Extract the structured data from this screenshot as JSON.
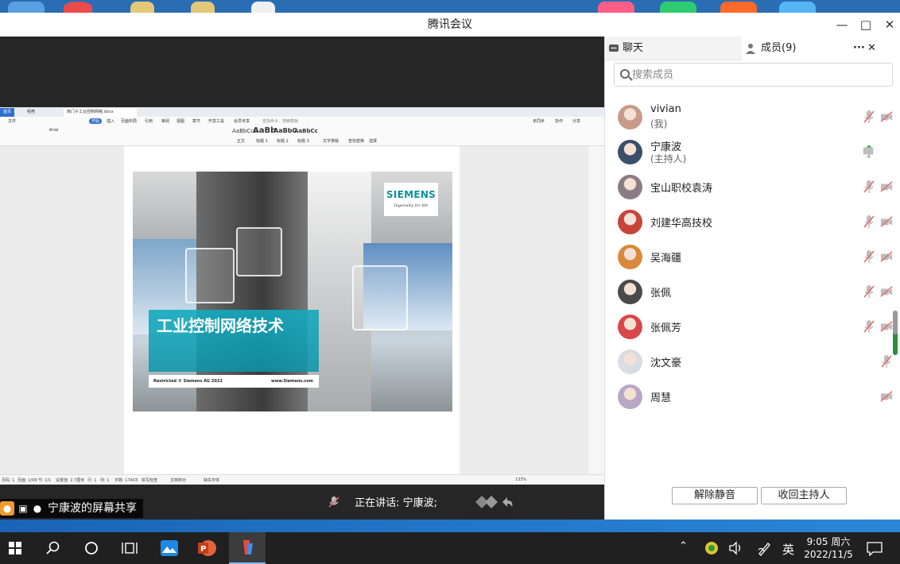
{
  "window": {
    "title": "腾讯会议"
  },
  "shared_screen": {
    "owner_label": "宁康波的屏幕共享",
    "speaking_prefix": "正在讲话:",
    "speaking_name": "宁康波;",
    "document": {
      "tabs": [
        "首页",
        "稻壳",
        "西门子工业控制网络.docx"
      ],
      "menu": [
        "文件",
        "开始",
        "插入",
        "页面布局",
        "引用",
        "审阅",
        "视图",
        "章节",
        "开发工具",
        "会员专享"
      ],
      "search_placeholder": "查找命令、搜索模板",
      "ribbon_styles": [
        "正文",
        "标题 1",
        "标题 2",
        "标题 3"
      ],
      "ribbon_tools": [
        "文字排版",
        "查找替换",
        "选择"
      ],
      "right_actions": [
        "未同步",
        "协作",
        "分享"
      ],
      "status": {
        "page": "页码: 1",
        "pages": "页面: 1/99",
        "section": "节: 1/1",
        "setting": "设置值: 2.7厘米",
        "row": "行: 1",
        "col": "列: 1",
        "words": "字数: 17403",
        "spell": "拼写检查",
        "proof": "文档校对",
        "font": "缺失字体",
        "zoom": "133%"
      },
      "slide": {
        "logo": "SIEMENS",
        "tagline": "Ingenuity for life",
        "title": "工业控制网络技术",
        "footer_left": "Restricted © Siemens AG 2022",
        "footer_right": "www.Siemens.com"
      }
    }
  },
  "panel": {
    "tab_chat": "聊天",
    "tab_members": "成员(9)",
    "more": "···",
    "close": "✕",
    "search_placeholder": "搜索成员",
    "members": [
      {
        "name": "vivian",
        "role": "(我)",
        "mic": "muted",
        "cam": "off",
        "avatar_color": "#c79b8a"
      },
      {
        "name": "宁康波",
        "role": "(主持人)",
        "mic": "on",
        "cam": "sharing",
        "avatar_color": "#3b4f6b"
      },
      {
        "name": "宝山职校袁涛",
        "role": "",
        "mic": "muted",
        "cam": "off",
        "avatar_color": "#8a7c84"
      },
      {
        "name": "刘建华高技校",
        "role": "",
        "mic": "muted",
        "cam": "off",
        "avatar_color": "#c8443a"
      },
      {
        "name": "吴海疆",
        "role": "",
        "mic": "muted",
        "cam": "off",
        "avatar_color": "#d9893b"
      },
      {
        "name": "张佩",
        "role": "",
        "mic": "muted",
        "cam": "off",
        "avatar_color": "#4a4a4a"
      },
      {
        "name": "张佩芳",
        "role": "",
        "mic": "muted",
        "cam": "off",
        "avatar_color": "#d6484b"
      },
      {
        "name": "沈文豪",
        "role": "",
        "mic": "muted",
        "cam": "none",
        "avatar_color": "#d9dde3"
      },
      {
        "name": "周慧",
        "role": "",
        "mic": "none",
        "cam": "off",
        "avatar_color": "#b9a7c6"
      }
    ],
    "btn_unmute_all": "解除静音",
    "btn_reclaim_host": "收回主持人"
  },
  "taskbar": {
    "ime": "英",
    "time": "9:05 周六",
    "date": "2022/11/5"
  },
  "colors": {
    "accent": "#2a8f3c",
    "muted_red": "#e86a6a",
    "mic_green": "#3db24a",
    "taskbar": "#202020"
  }
}
